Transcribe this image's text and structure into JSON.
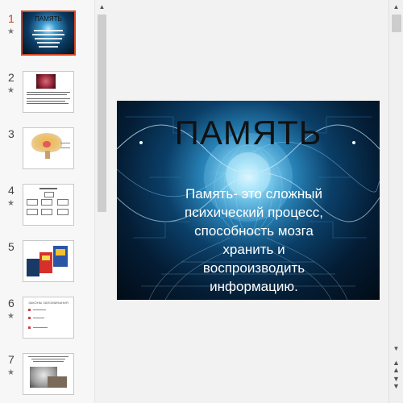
{
  "thumbnails": [
    {
      "number": "1",
      "starred": true,
      "active": true,
      "title": "ПАМЯТЬ"
    },
    {
      "number": "2",
      "starred": true,
      "active": false
    },
    {
      "number": "3",
      "starred": false,
      "active": false
    },
    {
      "number": "4",
      "starred": true,
      "active": false
    },
    {
      "number": "5",
      "starred": false,
      "active": false
    },
    {
      "number": "6",
      "starred": true,
      "active": false,
      "text": "ЗАКОНЫ ЗАПОМИНАНИЯ"
    },
    {
      "number": "7",
      "starred": true,
      "active": false
    }
  ],
  "slide": {
    "title": "ПАМЯТЬ",
    "body": "Память- это сложный психический процесс, способность мозга хранить и воспроизводить информацию."
  },
  "icons": {
    "star": "star-icon",
    "scroll_up": "scroll-up-arrow-icon",
    "scroll_down": "scroll-down-arrow-icon",
    "prev_slide": "previous-slide-icon",
    "next_slide": "next-slide-icon"
  },
  "colors": {
    "active_border": "#d24726",
    "active_number": "#c4421b",
    "slide_glow": "#7fd4f5"
  }
}
